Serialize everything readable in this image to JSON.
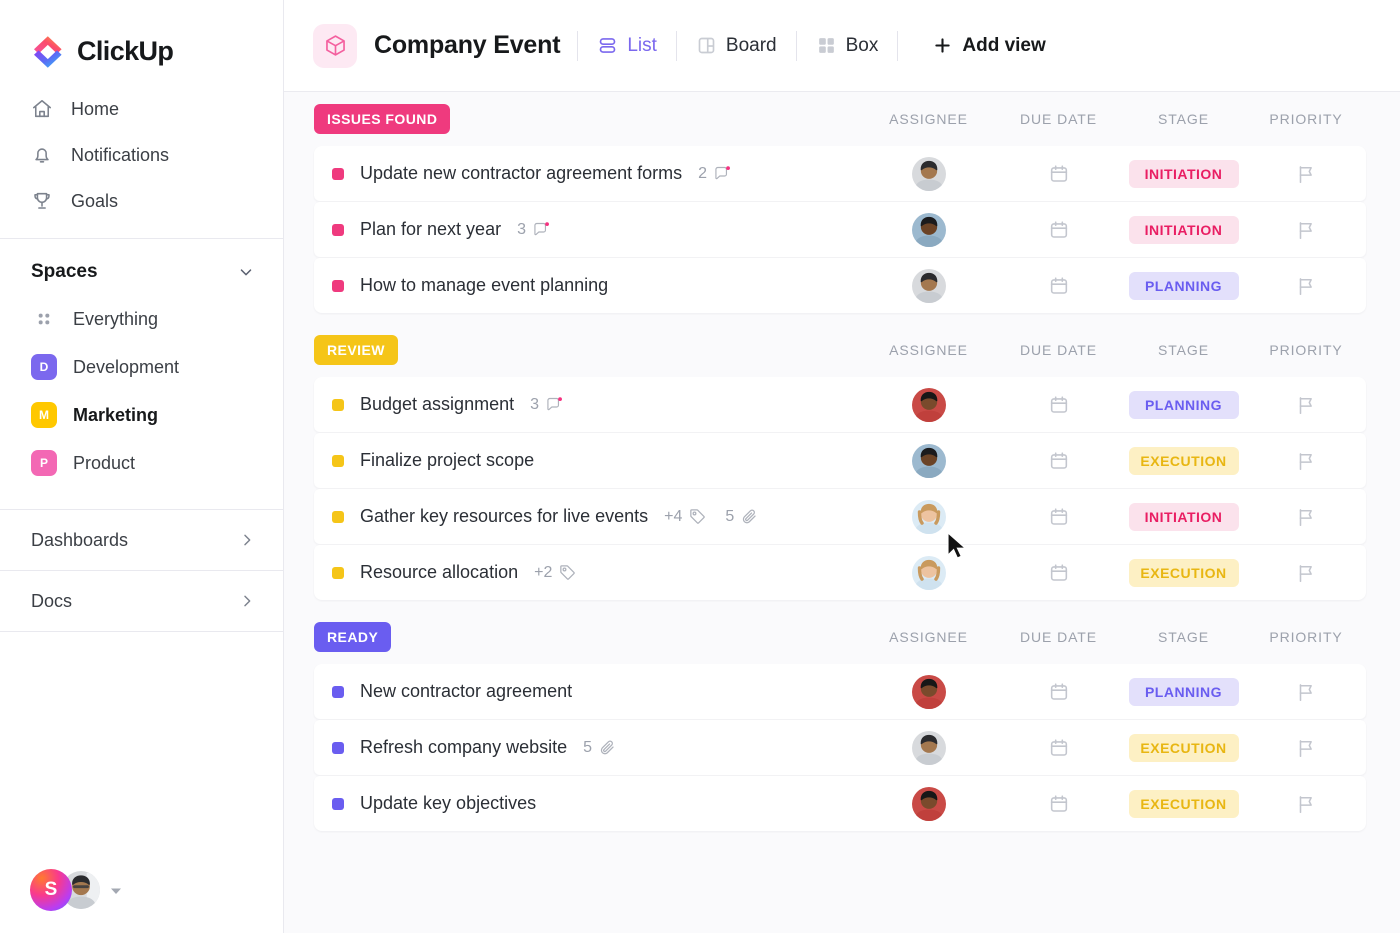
{
  "brand": {
    "name": "ClickUp",
    "logo_icon": "clickup-logo-icon"
  },
  "sidebar": {
    "nav": [
      {
        "label": "Home",
        "icon": "home-icon"
      },
      {
        "label": "Notifications",
        "icon": "bell-icon"
      },
      {
        "label": "Goals",
        "icon": "trophy-icon"
      }
    ],
    "spaces_header": {
      "label": "Spaces",
      "icon": "chevron-down-icon"
    },
    "spaces": [
      {
        "label": "Everything",
        "icon": "grid-dots-icon",
        "initial": "",
        "color": "",
        "active": false
      },
      {
        "label": "Development",
        "icon": "space-badge",
        "initial": "D",
        "color": "#7b68ee",
        "active": false
      },
      {
        "label": "Marketing",
        "icon": "space-badge",
        "initial": "M",
        "color": "#ffc800",
        "active": true
      },
      {
        "label": "Product",
        "icon": "space-badge",
        "initial": "P",
        "color": "#f368b4",
        "active": false
      }
    ],
    "sections": [
      {
        "label": "Dashboards",
        "icon": "chevron-right-icon"
      },
      {
        "label": "Docs",
        "icon": "chevron-right-icon"
      }
    ],
    "user_dock": {
      "workspace_initial": "S",
      "avatar": "user-avatar",
      "caret": "caret-down-icon"
    }
  },
  "topbar": {
    "list_icon": "cube-icon",
    "title": "Company Event",
    "views": [
      {
        "label": "List",
        "icon": "list-view-icon",
        "active": true
      },
      {
        "label": "Board",
        "icon": "board-view-icon",
        "active": false
      },
      {
        "label": "Box",
        "icon": "box-view-icon",
        "active": false
      }
    ],
    "add_view": {
      "label": "Add view",
      "icon": "plus-icon"
    }
  },
  "columns": {
    "assignee": "ASSIGNEE",
    "due_date": "DUE DATE",
    "stage": "STAGE",
    "priority": "PRIORITY"
  },
  "colors": {
    "issues_found": "#ef3a7e",
    "review": "#f5c518",
    "ready": "#6a5df0",
    "stage_initiation_bg": "#fbe2ec",
    "stage_initiation_fg": "#e91e63",
    "stage_planning_bg": "#e3e0fb",
    "stage_planning_fg": "#6a5df0",
    "stage_execution_bg": "#fdf0c4",
    "stage_execution_fg": "#e8b612",
    "accent_purple": "#7b68ee"
  },
  "groups": [
    {
      "name": "ISSUES FOUND",
      "badge_color": "#ef3a7e",
      "dot_color": "#ef3a7e",
      "tasks": [
        {
          "name": "Update new contractor agreement forms",
          "comments": "2",
          "comment_unread": true,
          "tags": "",
          "attachments": "",
          "assignee_skin": "#a4784f",
          "assignee_bg": "#d8dadd",
          "assignee_hair": "#2b2b2e",
          "stage": "INITIATION",
          "stage_bg": "#fbe2ec",
          "stage_fg": "#e91e63",
          "due_date": "",
          "priority": ""
        },
        {
          "name": "Plan for next year",
          "comments": "3",
          "comment_unread": true,
          "tags": "",
          "attachments": "",
          "assignee_skin": "#6b4326",
          "assignee_bg": "#9cb9cf",
          "assignee_hair": "#1b1b1d",
          "stage": "INITIATION",
          "stage_bg": "#fbe2ec",
          "stage_fg": "#e91e63",
          "due_date": "",
          "priority": ""
        },
        {
          "name": "How to manage event planning",
          "comments": "",
          "comment_unread": false,
          "tags": "",
          "attachments": "",
          "assignee_skin": "#a4784f",
          "assignee_bg": "#d8dadd",
          "assignee_hair": "#2b2b2e",
          "stage": "PLANNING",
          "stage_bg": "#e3e0fb",
          "stage_fg": "#6a5df0",
          "due_date": "",
          "priority": ""
        }
      ]
    },
    {
      "name": "REVIEW",
      "badge_color": "#f5c518",
      "dot_color": "#f5c518",
      "tasks": [
        {
          "name": "Budget assignment",
          "comments": "3",
          "comment_unread": true,
          "tags": "",
          "attachments": "",
          "assignee_skin": "#7a4a2c",
          "assignee_bg": "#c94a46",
          "assignee_hair": "#171717",
          "stage": "PLANNING",
          "stage_bg": "#e3e0fb",
          "stage_fg": "#6a5df0",
          "due_date": "",
          "priority": ""
        },
        {
          "name": "Finalize project scope",
          "comments": "",
          "comment_unread": false,
          "tags": "",
          "attachments": "",
          "assignee_skin": "#6b4326",
          "assignee_bg": "#9cb9cf",
          "assignee_hair": "#1b1b1d",
          "stage": "EXECUTION",
          "stage_bg": "#fdf0c4",
          "stage_fg": "#e8b612",
          "due_date": "",
          "priority": ""
        },
        {
          "name": "Gather key resources for live events",
          "comments": "",
          "comment_unread": false,
          "tags": "+4",
          "attachments": "5",
          "assignee_skin": "#edc3a0",
          "assignee_bg": "#dcebf5",
          "assignee_hair": "#c99a5e",
          "stage": "INITIATION",
          "stage_bg": "#fbe2ec",
          "stage_fg": "#e91e63",
          "due_date": "",
          "priority": ""
        },
        {
          "name": "Resource allocation",
          "comments": "",
          "comment_unread": false,
          "tags": "+2",
          "attachments": "",
          "assignee_skin": "#edc3a0",
          "assignee_bg": "#dcebf5",
          "assignee_hair": "#c99a5e",
          "stage": "EXECUTION",
          "stage_bg": "#fdf0c4",
          "stage_fg": "#e8b612",
          "due_date": "",
          "priority": ""
        }
      ]
    },
    {
      "name": "READY",
      "badge_color": "#6a5df0",
      "dot_color": "#6a5df0",
      "tasks": [
        {
          "name": "New contractor agreement",
          "comments": "",
          "comment_unread": false,
          "tags": "",
          "attachments": "",
          "assignee_skin": "#7a4a2c",
          "assignee_bg": "#c94a46",
          "assignee_hair": "#171717",
          "stage": "PLANNING",
          "stage_bg": "#e3e0fb",
          "stage_fg": "#6a5df0",
          "due_date": "",
          "priority": ""
        },
        {
          "name": "Refresh company website",
          "comments": "",
          "comment_unread": false,
          "tags": "",
          "attachments": "5",
          "assignee_skin": "#a4784f",
          "assignee_bg": "#d8dadd",
          "assignee_hair": "#2b2b2e",
          "stage": "EXECUTION",
          "stage_bg": "#fdf0c4",
          "stage_fg": "#e8b612",
          "due_date": "",
          "priority": ""
        },
        {
          "name": "Update key objectives",
          "comments": "",
          "comment_unread": false,
          "tags": "",
          "attachments": "",
          "assignee_skin": "#7a4a2c",
          "assignee_bg": "#c94a46",
          "assignee_hair": "#171717",
          "stage": "EXECUTION",
          "stage_bg": "#fdf0c4",
          "stage_fg": "#e8b612",
          "due_date": "",
          "priority": ""
        }
      ]
    }
  ]
}
